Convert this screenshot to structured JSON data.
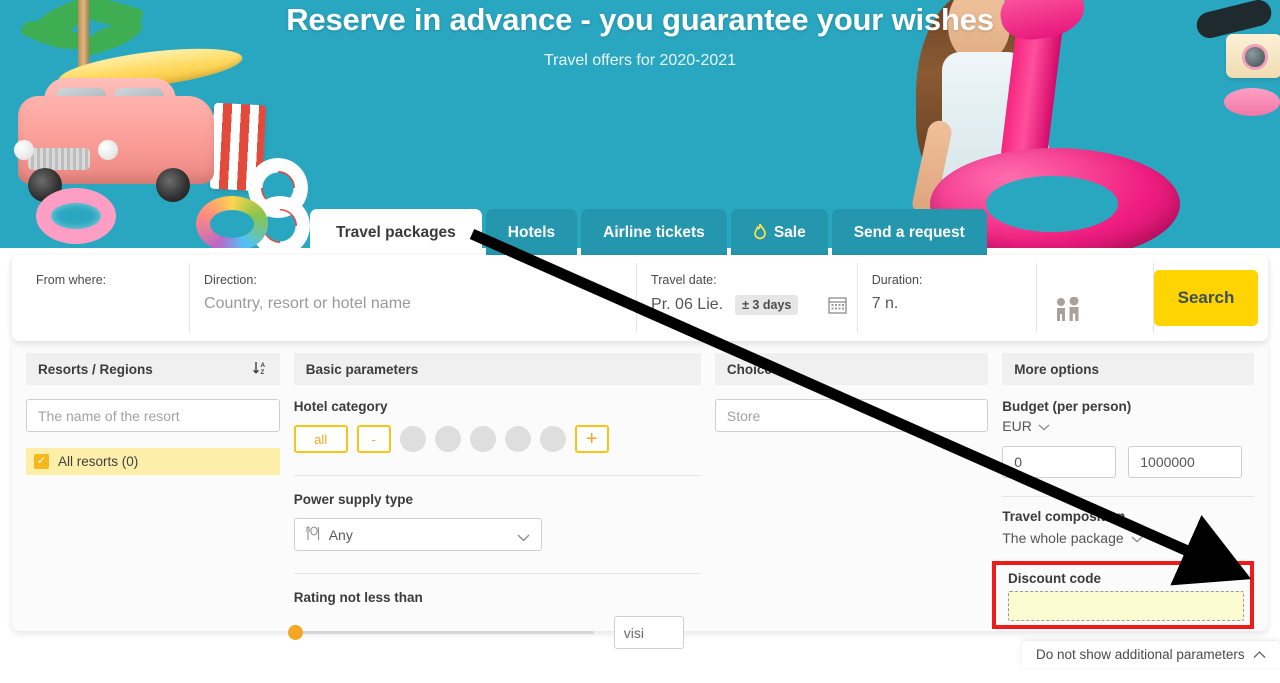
{
  "hero": {
    "title": "Reserve in advance - you guarantee your wishes",
    "subtitle": "Travel offers for 2020-2021",
    "bg_color": "#2aa7c0"
  },
  "tabs": [
    {
      "label": "Travel packages",
      "active": true,
      "icon": ""
    },
    {
      "label": "Hotels",
      "active": false,
      "icon": ""
    },
    {
      "label": "Airline tickets",
      "active": false,
      "icon": ""
    },
    {
      "label": "Sale",
      "active": false,
      "icon": "flame-icon"
    },
    {
      "label": "Send a request",
      "active": false,
      "icon": ""
    }
  ],
  "search": {
    "from_label": "From where:",
    "from_value": "",
    "direction_label": "Direction:",
    "direction_placeholder": "Country, resort or hotel name",
    "date_label": "Travel date:",
    "date_value": "Pr. 06 Lie.",
    "date_flex": "± 3 days",
    "duration_label": "Duration:",
    "duration_value": "7 n.",
    "pax_icon": "two-people-icon",
    "search_button": "Search",
    "button_color": "#ffd400"
  },
  "resorts": {
    "header": "Resorts / Regions",
    "sort_icon": "sort-az-icon",
    "search_placeholder": "The name of the resort",
    "search_value": "",
    "all_item": "All resorts (0)",
    "all_checked": true,
    "highlight_color": "#fdeeaa"
  },
  "basic": {
    "header": "Basic parameters",
    "hotel_category_label": "Hotel category",
    "category_all": "all",
    "category_minus": "-",
    "category_plus": "+",
    "star_dots": 5,
    "power_label": "Power supply type",
    "power_icon": "cutlery-icon",
    "power_value": "Any",
    "rating_label": "Rating not less than",
    "rating_value": "visi",
    "rating_slider_percent": 0
  },
  "choices": {
    "header": "Choices",
    "input_placeholder": "Store",
    "input_value": ""
  },
  "more": {
    "header": "More options",
    "budget_label": "Budget (per person)",
    "currency": "EUR",
    "budget_min": "0",
    "budget_max": "1000000",
    "composition_label": "Travel composition",
    "composition_value": "The whole package",
    "discount_label": "Discount code",
    "discount_value": "",
    "discount_border_color": "#ee1b1b"
  },
  "footer": {
    "toggle_label": "Do not show additional parameters",
    "toggle_icon": "chevron-up-icon"
  },
  "annotation": {
    "arrow_color": "#000000",
    "arrow_from": "travel-packages-tab",
    "arrow_to": "discount-code-field"
  }
}
